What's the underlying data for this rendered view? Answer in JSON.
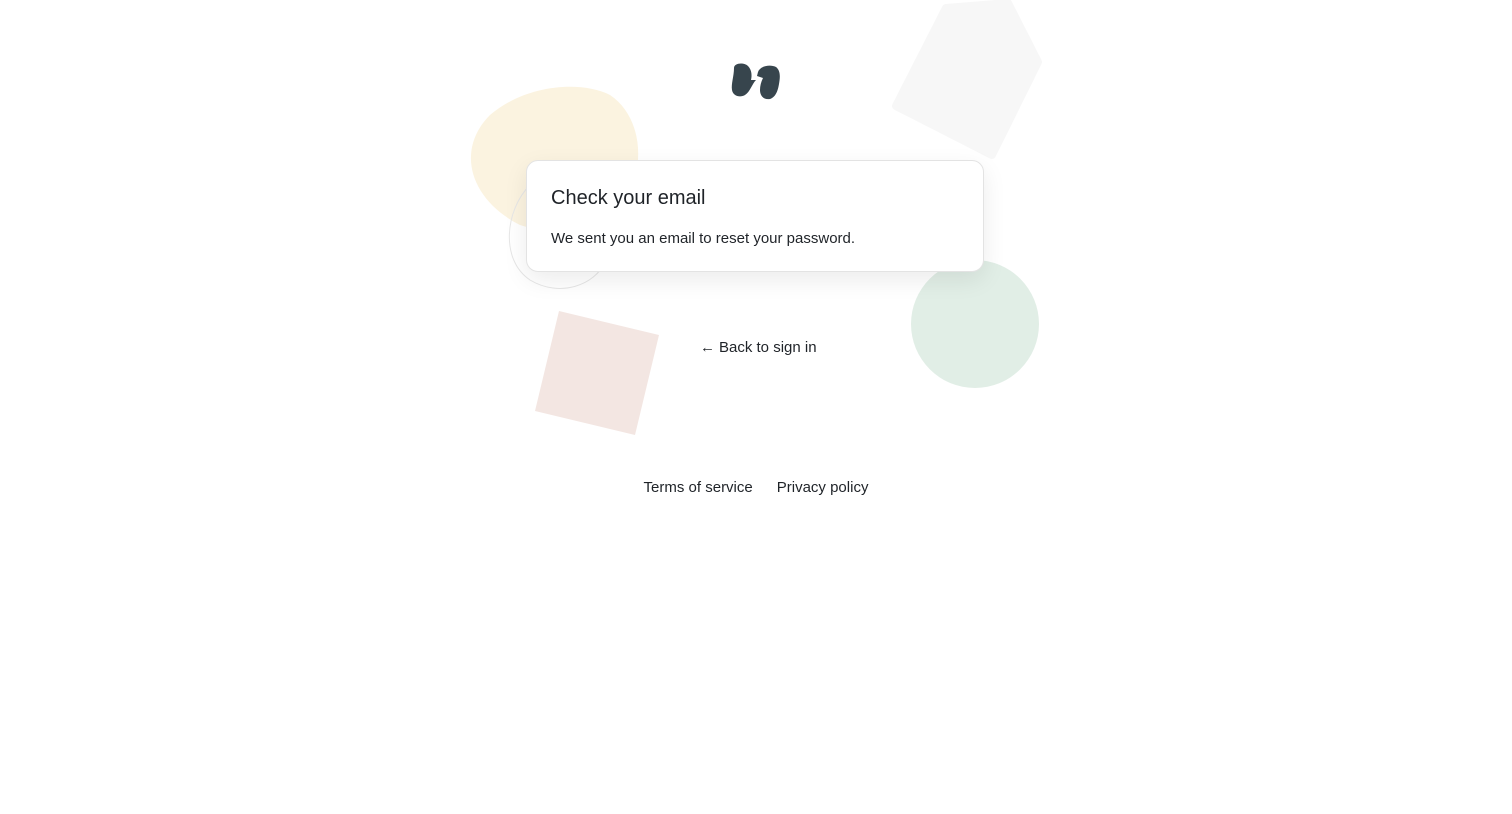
{
  "brand": {
    "logo_icon": "quote-mark-logo-icon",
    "logo_color": "#37454d"
  },
  "card": {
    "title": "Check your email",
    "message": "We sent you an email to reset your password."
  },
  "navigation": {
    "back_arrow": "←",
    "back_label": "Back to sign in"
  },
  "footer": {
    "terms_label": "Terms of service",
    "privacy_label": "Privacy policy"
  },
  "decorations": {
    "blob_color": "#fbf3e0",
    "circle_color": "#e1eee6",
    "square_color": "#f3e6e2",
    "pentagon_color": "#f7f7f7",
    "outline_color": "#e6e6e6"
  }
}
